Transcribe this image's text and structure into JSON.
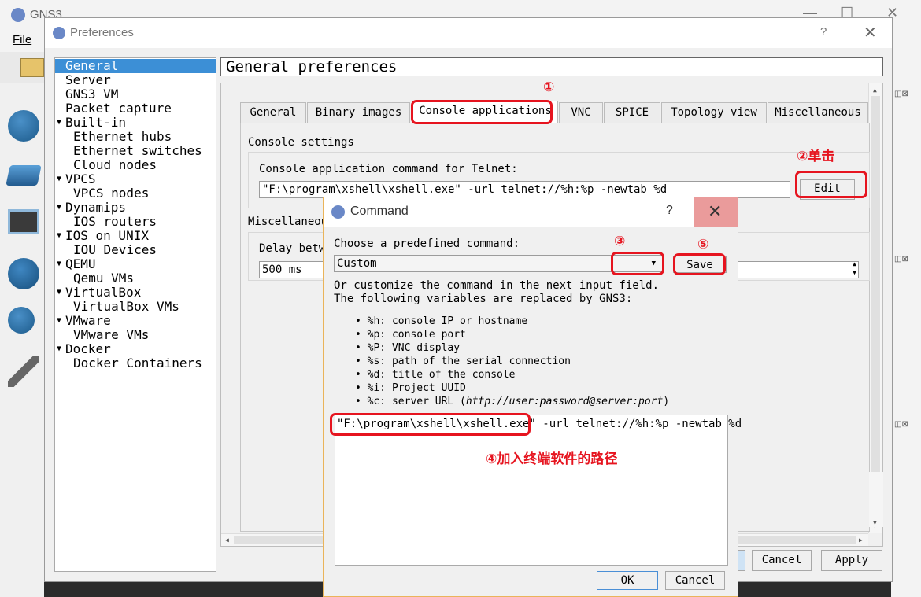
{
  "gns3_window": {
    "title": "GNS3",
    "menu_file": "File"
  },
  "preferences": {
    "title": "Preferences",
    "help": "?",
    "close": "✕",
    "header": "General preferences",
    "tree": [
      {
        "label": "General",
        "level": 0,
        "selected": true
      },
      {
        "label": "Server",
        "level": 0
      },
      {
        "label": "GNS3 VM",
        "level": 0
      },
      {
        "label": "Packet capture",
        "level": 0
      },
      {
        "label": "Built-in",
        "level": 0,
        "expanded": true
      },
      {
        "label": "Ethernet hubs",
        "level": 1
      },
      {
        "label": "Ethernet switches",
        "level": 1
      },
      {
        "label": "Cloud nodes",
        "level": 1
      },
      {
        "label": "VPCS",
        "level": 0,
        "expanded": true
      },
      {
        "label": "VPCS nodes",
        "level": 1
      },
      {
        "label": "Dynamips",
        "level": 0,
        "expanded": true
      },
      {
        "label": "IOS routers",
        "level": 1
      },
      {
        "label": "IOS on UNIX",
        "level": 0,
        "expanded": true
      },
      {
        "label": "IOU Devices",
        "level": 1
      },
      {
        "label": "QEMU",
        "level": 0,
        "expanded": true
      },
      {
        "label": "Qemu VMs",
        "level": 1
      },
      {
        "label": "VirtualBox",
        "level": 0,
        "expanded": true
      },
      {
        "label": "VirtualBox VMs",
        "level": 1
      },
      {
        "label": "VMware",
        "level": 0,
        "expanded": true
      },
      {
        "label": "VMware VMs",
        "level": 1
      },
      {
        "label": "Docker",
        "level": 0,
        "expanded": true
      },
      {
        "label": "Docker Containers",
        "level": 1
      }
    ],
    "tabs": [
      {
        "label": "General"
      },
      {
        "label": "Binary images"
      },
      {
        "label": "Console applications",
        "active": true
      },
      {
        "label": "VNC"
      },
      {
        "label": "SPICE"
      },
      {
        "label": "Topology view"
      },
      {
        "label": "Miscellaneous"
      }
    ],
    "console_settings": {
      "group_label": "Console settings",
      "telnet_label": "Console application command for Telnet:",
      "telnet_value": "\"F:\\program\\xshell\\xshell.exe\" -url telnet://%h:%p -newtab %d",
      "edit_button": "Edit"
    },
    "misc": {
      "group_label": "Miscellaneou",
      "delay_label": "Delay betw",
      "delay_value": "500 ms"
    },
    "buttons": {
      "cancel": "Cancel",
      "apply": "Apply"
    }
  },
  "command_dialog": {
    "title": "Command",
    "help": "?",
    "close": "✕",
    "predefined_label": "Choose a predefined command:",
    "predefined_value": "Custom",
    "save_button": "Save",
    "customize_text_1": "Or customize the command in the next input field.",
    "customize_text_2": "The following variables are replaced by GNS3:",
    "variables": [
      "%h: console IP or hostname",
      "%p: console port",
      "%P: VNC display",
      "%s: path of the serial connection",
      "%d: title of the console",
      "%i: Project UUID"
    ],
    "server_url_prefix": "%c: server URL (",
    "server_url_example": "http://user:password@server:port",
    "server_url_suffix": ")",
    "command_value_part1": "\"F:\\program\\xshell\\xshell.exe\"",
    "command_value_part2": " -url telnet://%h:%p -newtab %d",
    "ok_button": "OK",
    "cancel_button": "Cancel"
  },
  "annotations": {
    "step1": "①",
    "step2": "②单击",
    "step3": "③",
    "step4": "④加入终端软件的路径",
    "step5": "⑤",
    "color": "#e6141f"
  }
}
